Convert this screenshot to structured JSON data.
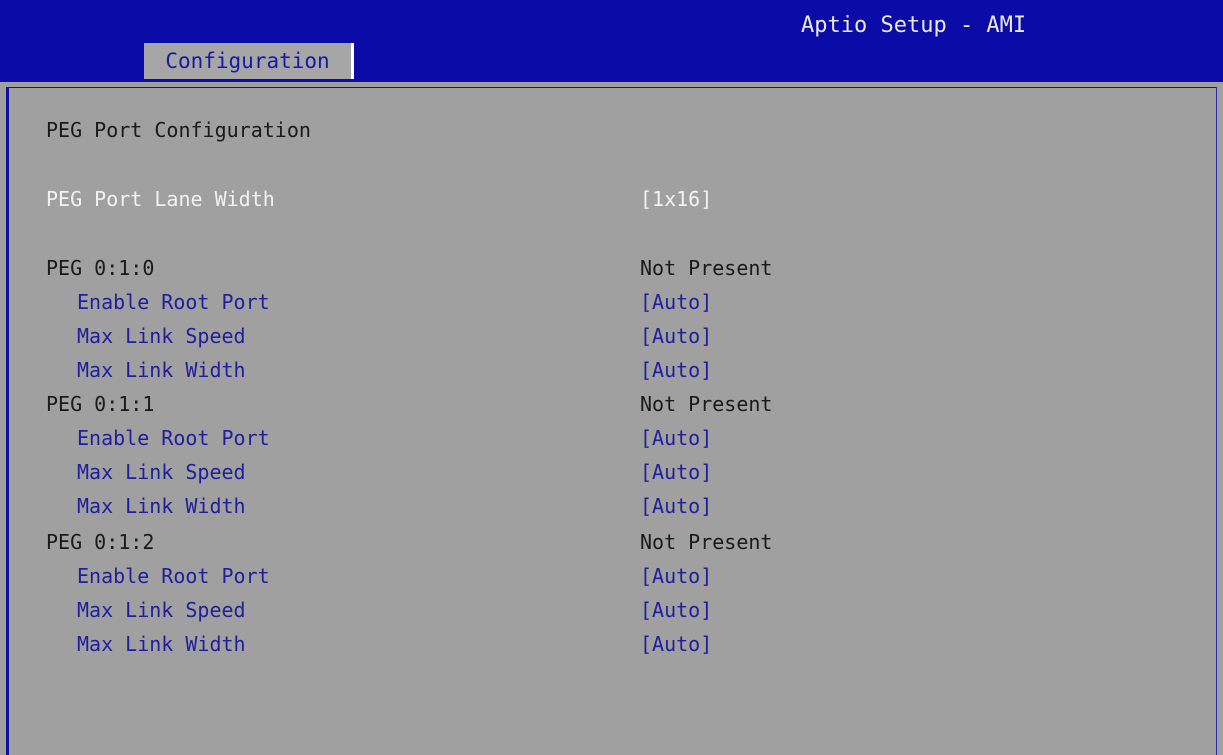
{
  "window": {
    "title": "Aptio Setup - AMI"
  },
  "tabs": {
    "active_label": "Configuration"
  },
  "section": {
    "title": "PEG Port Configuration"
  },
  "lane_width": {
    "label": "PEG Port Lane Width",
    "value": "[1x16]"
  },
  "ports": [
    {
      "name": "PEG 0:1:0",
      "status": "Not Present",
      "settings": [
        {
          "label": "Enable Root Port",
          "value": "[Auto]"
        },
        {
          "label": "Max Link Speed",
          "value": "[Auto]"
        },
        {
          "label": "Max Link Width",
          "value": "[Auto]"
        }
      ]
    },
    {
      "name": "PEG 0:1:1",
      "status": "Not Present",
      "settings": [
        {
          "label": "Enable Root Port",
          "value": "[Auto]"
        },
        {
          "label": "Max Link Speed",
          "value": "[Auto]"
        },
        {
          "label": "Max Link Width",
          "value": "[Auto]"
        }
      ]
    },
    {
      "name": "PEG 0:1:2",
      "status": "Not Present",
      "settings": [
        {
          "label": "Enable Root Port",
          "value": "[Auto]"
        },
        {
          "label": "Max Link Speed",
          "value": "[Auto]"
        },
        {
          "label": "Max Link Width",
          "value": "[Auto]"
        }
      ]
    }
  ],
  "colors": {
    "header_bg": "#0b0ba8",
    "panel_bg": "#a0a0a0",
    "setting_text": "#1f1f9e",
    "highlight_text": "#f2f2f2",
    "static_text": "#1a1a1a"
  }
}
